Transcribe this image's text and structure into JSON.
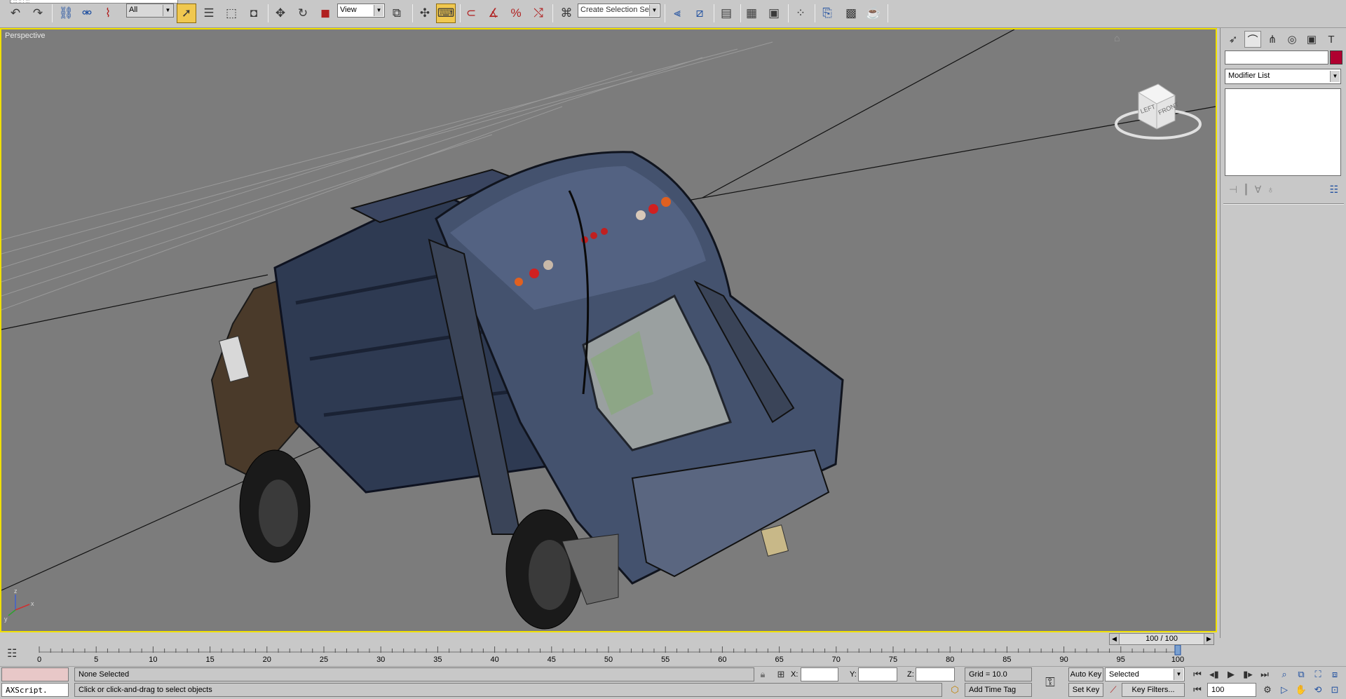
{
  "toolbar": {
    "selection_filter": "All",
    "reference_coord": "View",
    "named_selection_placeholder": "Create Selection Set",
    "colors": {
      "active_tool": "#f0c850",
      "viewport_border": "#f0e000"
    },
    "icons": [
      "undo-icon",
      "redo-icon",
      "select-link-icon",
      "unlink-icon",
      "bind-spacewarp-icon",
      "select-object-icon",
      "select-by-name-icon",
      "rectangular-region-icon",
      "window-crossing-icon",
      "move-icon",
      "rotate-icon",
      "scale-icon",
      "pivot-center-icon",
      "manipulate-icon",
      "keyboard-shortcut-icon",
      "snaps-3d-icon",
      "angle-snap-icon",
      "percent-snap-icon",
      "spinner-snap-icon",
      "edit-named-selection-icon",
      "mirror-icon",
      "align-icon",
      "layer-manager-icon",
      "curve-editor-icon",
      "schematic-view-icon",
      "material-editor-icon",
      "render-setup-icon",
      "rendered-frame-icon",
      "quick-render-icon"
    ]
  },
  "viewport": {
    "label": "Perspective",
    "background": "#7c7c7c",
    "viewcube": {
      "face_left": "LEFT",
      "face_front": "FRONT"
    },
    "axis": {
      "z": "z",
      "x": "x",
      "y": "y"
    }
  },
  "command_panel": {
    "tabs": [
      "create-tab-icon",
      "modify-tab-icon",
      "hierarchy-tab-icon",
      "motion-tab-icon",
      "display-tab-icon",
      "utilities-tab-icon"
    ],
    "object_name": "",
    "object_color": "#b00030",
    "modifier_list": "Modifier List"
  },
  "timeline": {
    "slider_text": "100 / 100",
    "ticks": [
      "0",
      "5",
      "10",
      "15",
      "20",
      "25",
      "30",
      "35",
      "40",
      "45",
      "50",
      "55",
      "60",
      "65",
      "70",
      "75",
      "80",
      "85",
      "90",
      "95",
      "100"
    ]
  },
  "status": {
    "maxscript": "AXScript.",
    "selection": "None Selected",
    "prompt": "Click or click-and-drag to select objects",
    "x_label": "X:",
    "y_label": "Y:",
    "z_label": "Z:",
    "grid": "Grid = 10.0",
    "add_time_tag": "Add Time Tag",
    "auto_key": "Auto Key",
    "set_key": "Set Key",
    "key_mode": "Selected",
    "key_filters": "Key Filters...",
    "current_frame": "100"
  }
}
